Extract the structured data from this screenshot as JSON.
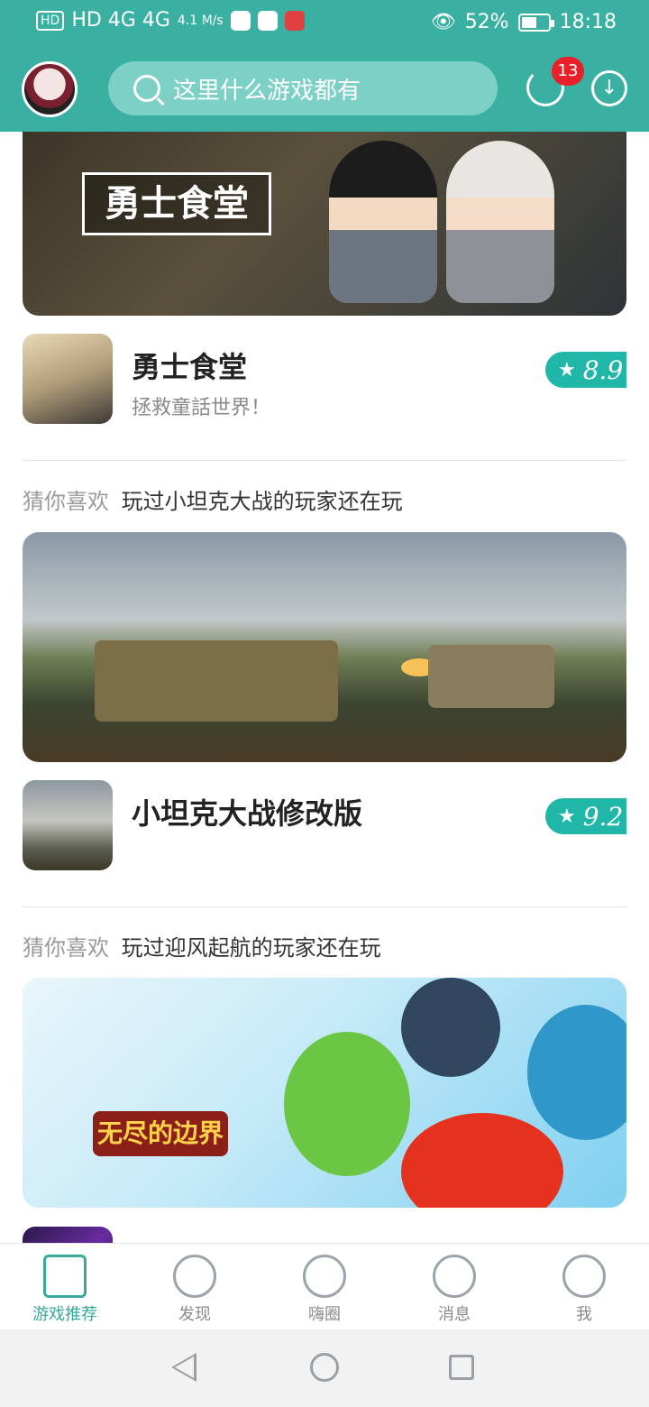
{
  "status": {
    "network": "HD 4G 4G",
    "speed": "4.1\nM/s",
    "eye_battery": "52%",
    "time": "18:18"
  },
  "header": {
    "search_placeholder": "这里什么游戏都有",
    "update_badge": "13"
  },
  "banner1": {
    "title_art": "勇士食堂"
  },
  "games": [
    {
      "name": "勇士食堂",
      "desc": "拯救童話世界！",
      "rating": "8.9"
    },
    {
      "name": "小坦克大战修改版",
      "desc": "",
      "rating": "9.2"
    }
  ],
  "sections": [
    {
      "prefix": "猜你喜欢",
      "text": "玩过小坦克大战的玩家还在玩"
    },
    {
      "prefix": "猜你喜欢",
      "text": "玩过迎风起航的玩家还在玩"
    }
  ],
  "banner3": {
    "logo": "无尽的边界"
  },
  "bottom_nav": [
    {
      "label": "游戏推荐",
      "icon": "home-icon"
    },
    {
      "label": "发现",
      "icon": "radar-icon"
    },
    {
      "label": "嗨圈",
      "icon": "community-icon"
    },
    {
      "label": "消息",
      "icon": "chat-icon"
    },
    {
      "label": "我",
      "icon": "profile-icon"
    }
  ],
  "colors": {
    "accent": "#3ab0a3",
    "rating": "#21b7a8",
    "badge": "#e8202a"
  }
}
